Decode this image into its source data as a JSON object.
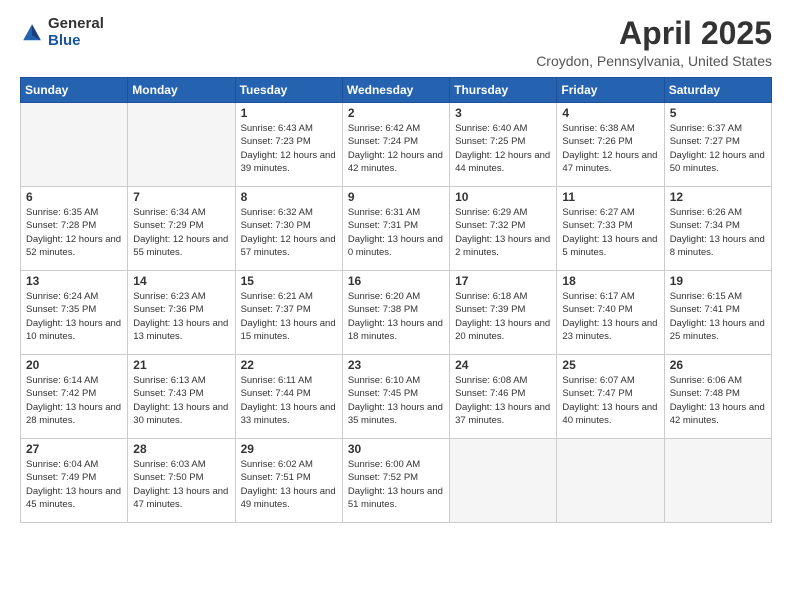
{
  "logo": {
    "general": "General",
    "blue": "Blue"
  },
  "header": {
    "month": "April 2025",
    "location": "Croydon, Pennsylvania, United States"
  },
  "weekdays": [
    "Sunday",
    "Monday",
    "Tuesday",
    "Wednesday",
    "Thursday",
    "Friday",
    "Saturday"
  ],
  "weeks": [
    [
      {
        "day": "",
        "info": ""
      },
      {
        "day": "",
        "info": ""
      },
      {
        "day": "1",
        "info": "Sunrise: 6:43 AM\nSunset: 7:23 PM\nDaylight: 12 hours and 39 minutes."
      },
      {
        "day": "2",
        "info": "Sunrise: 6:42 AM\nSunset: 7:24 PM\nDaylight: 12 hours and 42 minutes."
      },
      {
        "day": "3",
        "info": "Sunrise: 6:40 AM\nSunset: 7:25 PM\nDaylight: 12 hours and 44 minutes."
      },
      {
        "day": "4",
        "info": "Sunrise: 6:38 AM\nSunset: 7:26 PM\nDaylight: 12 hours and 47 minutes."
      },
      {
        "day": "5",
        "info": "Sunrise: 6:37 AM\nSunset: 7:27 PM\nDaylight: 12 hours and 50 minutes."
      }
    ],
    [
      {
        "day": "6",
        "info": "Sunrise: 6:35 AM\nSunset: 7:28 PM\nDaylight: 12 hours and 52 minutes."
      },
      {
        "day": "7",
        "info": "Sunrise: 6:34 AM\nSunset: 7:29 PM\nDaylight: 12 hours and 55 minutes."
      },
      {
        "day": "8",
        "info": "Sunrise: 6:32 AM\nSunset: 7:30 PM\nDaylight: 12 hours and 57 minutes."
      },
      {
        "day": "9",
        "info": "Sunrise: 6:31 AM\nSunset: 7:31 PM\nDaylight: 13 hours and 0 minutes."
      },
      {
        "day": "10",
        "info": "Sunrise: 6:29 AM\nSunset: 7:32 PM\nDaylight: 13 hours and 2 minutes."
      },
      {
        "day": "11",
        "info": "Sunrise: 6:27 AM\nSunset: 7:33 PM\nDaylight: 13 hours and 5 minutes."
      },
      {
        "day": "12",
        "info": "Sunrise: 6:26 AM\nSunset: 7:34 PM\nDaylight: 13 hours and 8 minutes."
      }
    ],
    [
      {
        "day": "13",
        "info": "Sunrise: 6:24 AM\nSunset: 7:35 PM\nDaylight: 13 hours and 10 minutes."
      },
      {
        "day": "14",
        "info": "Sunrise: 6:23 AM\nSunset: 7:36 PM\nDaylight: 13 hours and 13 minutes."
      },
      {
        "day": "15",
        "info": "Sunrise: 6:21 AM\nSunset: 7:37 PM\nDaylight: 13 hours and 15 minutes."
      },
      {
        "day": "16",
        "info": "Sunrise: 6:20 AM\nSunset: 7:38 PM\nDaylight: 13 hours and 18 minutes."
      },
      {
        "day": "17",
        "info": "Sunrise: 6:18 AM\nSunset: 7:39 PM\nDaylight: 13 hours and 20 minutes."
      },
      {
        "day": "18",
        "info": "Sunrise: 6:17 AM\nSunset: 7:40 PM\nDaylight: 13 hours and 23 minutes."
      },
      {
        "day": "19",
        "info": "Sunrise: 6:15 AM\nSunset: 7:41 PM\nDaylight: 13 hours and 25 minutes."
      }
    ],
    [
      {
        "day": "20",
        "info": "Sunrise: 6:14 AM\nSunset: 7:42 PM\nDaylight: 13 hours and 28 minutes."
      },
      {
        "day": "21",
        "info": "Sunrise: 6:13 AM\nSunset: 7:43 PM\nDaylight: 13 hours and 30 minutes."
      },
      {
        "day": "22",
        "info": "Sunrise: 6:11 AM\nSunset: 7:44 PM\nDaylight: 13 hours and 33 minutes."
      },
      {
        "day": "23",
        "info": "Sunrise: 6:10 AM\nSunset: 7:45 PM\nDaylight: 13 hours and 35 minutes."
      },
      {
        "day": "24",
        "info": "Sunrise: 6:08 AM\nSunset: 7:46 PM\nDaylight: 13 hours and 37 minutes."
      },
      {
        "day": "25",
        "info": "Sunrise: 6:07 AM\nSunset: 7:47 PM\nDaylight: 13 hours and 40 minutes."
      },
      {
        "day": "26",
        "info": "Sunrise: 6:06 AM\nSunset: 7:48 PM\nDaylight: 13 hours and 42 minutes."
      }
    ],
    [
      {
        "day": "27",
        "info": "Sunrise: 6:04 AM\nSunset: 7:49 PM\nDaylight: 13 hours and 45 minutes."
      },
      {
        "day": "28",
        "info": "Sunrise: 6:03 AM\nSunset: 7:50 PM\nDaylight: 13 hours and 47 minutes."
      },
      {
        "day": "29",
        "info": "Sunrise: 6:02 AM\nSunset: 7:51 PM\nDaylight: 13 hours and 49 minutes."
      },
      {
        "day": "30",
        "info": "Sunrise: 6:00 AM\nSunset: 7:52 PM\nDaylight: 13 hours and 51 minutes."
      },
      {
        "day": "",
        "info": ""
      },
      {
        "day": "",
        "info": ""
      },
      {
        "day": "",
        "info": ""
      }
    ]
  ]
}
